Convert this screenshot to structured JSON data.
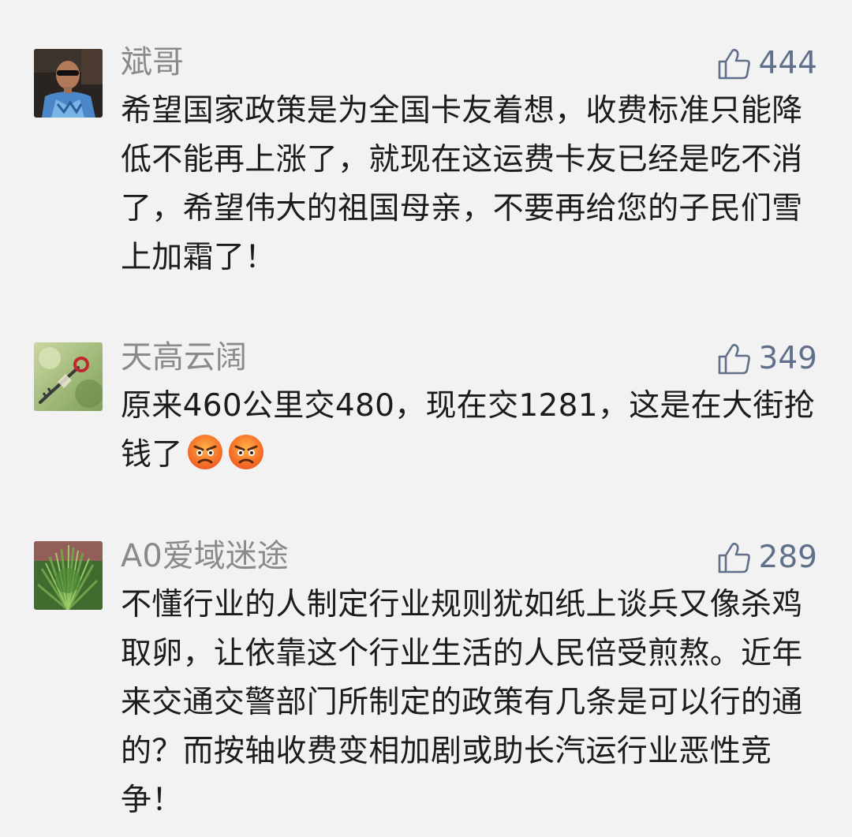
{
  "comments": [
    {
      "username": "斌哥",
      "likes": "444",
      "text": "希望国家政策是为全国卡友着想，收费标准只能降低不能再上涨了，就现在这运费卡友已经是吃不消了，希望伟大的祖国母亲，不要再给您的子民们雪上加霜了！",
      "emoji_count": 0
    },
    {
      "username": "天高云阔",
      "likes": "349",
      "text": "原来460公里交480，现在交1281，这是在大街抢钱了",
      "emoji_count": 2,
      "emoji_name": "angry-face-icon"
    },
    {
      "username": "A0爱域迷途",
      "likes": "289",
      "text": "不懂行业的人制定行业规则犹如纸上谈兵又像杀鸡取卵，让依靠这个行业生活的人民倍受煎熬。近年来交通交警部门所制定的政策有几条是可以行的通的？而按轴收费变相加剧或助长汽运行业恶性竞争！",
      "emoji_count": 0
    }
  ],
  "colors": {
    "background": "#f2f2f2",
    "username": "#8a8a8a",
    "like_count": "#61708a",
    "text": "#1c1c1c"
  },
  "icons": {
    "like": "thumbs-up-outline-icon"
  }
}
